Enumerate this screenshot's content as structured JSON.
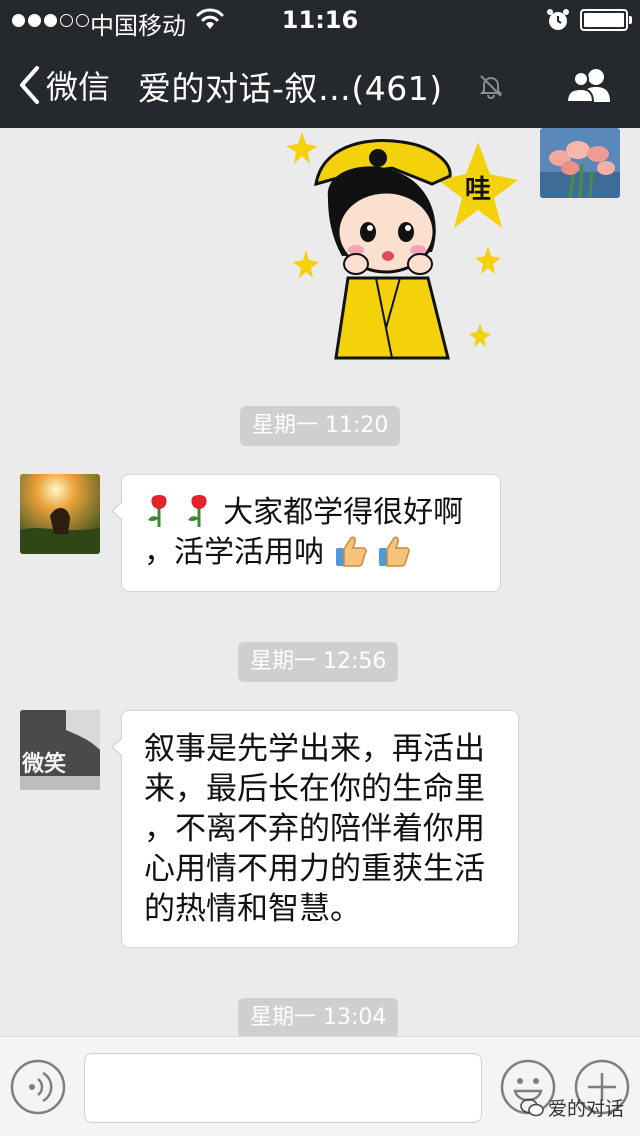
{
  "status_bar": {
    "carrier": "中国移动",
    "time": "11:16"
  },
  "nav": {
    "back_label": "微信",
    "title": "爱的对话-叙…(461)"
  },
  "messages": {
    "sticker_text": "哇",
    "timestamp_1": "星期一 11:20",
    "msg_1_line1": "大家都学得很好啊",
    "msg_1_line2": "，活学活用呐",
    "timestamp_2": "星期一 12:56",
    "msg_2_lines": [
      "叙事是先学出来，再活出",
      "来，最后长在你的生命里",
      "，不离不弃的陪伴着你用",
      "心用情不用力的重获生活",
      "的热情和智慧。"
    ],
    "avatar_2_text": "微笑",
    "timestamp_3": "星期一 13:04"
  },
  "watermark": "爱的对话",
  "colors": {
    "nav_bg": "#25292d",
    "chat_bg": "#ebebeb",
    "timestamp_bg": "#cfcfcf"
  },
  "icons": {
    "back": "chevron-left-icon",
    "mute": "mute-icon",
    "people": "people-icon",
    "voice": "voice-icon",
    "emoji": "emoji-icon",
    "plus": "plus-icon"
  }
}
